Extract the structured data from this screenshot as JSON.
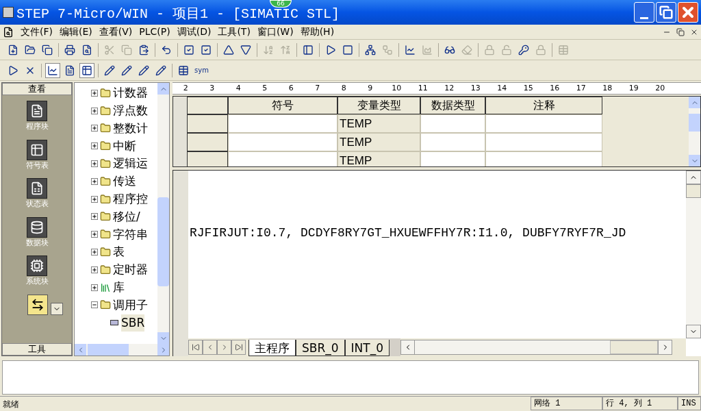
{
  "window": {
    "title": "STEP 7-Micro/WIN - 项目1 - [SIMATIC STL]",
    "badge": "66"
  },
  "menu": [
    "文件(F)",
    "编辑(E)",
    "查看(V)",
    "PLC(P)",
    "调试(D)",
    "工具(T)",
    "窗口(W)",
    "帮助(H)"
  ],
  "toolbar_1": [
    {
      "disabled": false
    },
    {
      "disabled": false
    },
    {
      "disabled": false
    },
    {
      "disabled": false
    },
    {
      "disabled": false
    },
    {
      "disabled": true
    },
    {
      "disabled": true
    },
    {
      "disabled": false
    },
    {
      "disabled": false
    },
    {
      "disabled": false
    },
    {
      "disabled": false
    },
    {
      "disabled": false
    },
    {
      "disabled": false
    },
    {
      "disabled": true
    },
    {
      "disabled": true
    },
    {
      "disabled": false
    },
    {
      "disabled": false
    },
    {
      "disabled": false
    },
    {
      "disabled": false
    },
    {
      "disabled": true
    },
    {
      "disabled": false
    },
    {
      "disabled": true
    },
    {
      "disabled": false
    },
    {
      "disabled": true
    },
    {
      "disabled": true
    },
    {
      "disabled": true
    },
    {
      "disabled": false
    },
    {
      "disabled": true
    },
    {
      "disabled": true
    }
  ],
  "toolbar_2": [
    {
      "pressed": false
    },
    {
      "pressed": false
    },
    {
      "pressed": true
    },
    {
      "pressed": false
    },
    {
      "pressed": true
    },
    {
      "pressed": false
    },
    {
      "pressed": false
    },
    {
      "pressed": false
    },
    {
      "pressed": false
    },
    {
      "pressed": false
    },
    {
      "pressed": false
    }
  ],
  "toolbar_2_label": "sym",
  "navigation_bar": {
    "header": "查看",
    "items": [
      {
        "label": "程序块"
      },
      {
        "label": "符号表"
      },
      {
        "label": "状态表"
      },
      {
        "label": "数据块"
      },
      {
        "label": "系统块"
      }
    ],
    "footer": "工具"
  },
  "tree": [
    {
      "label": "计数器",
      "expanded": false
    },
    {
      "label": "浮点数",
      "expanded": false
    },
    {
      "label": "整数计",
      "expanded": false
    },
    {
      "label": "中断",
      "expanded": false
    },
    {
      "label": "逻辑运",
      "expanded": false
    },
    {
      "label": "传送",
      "expanded": false
    },
    {
      "label": "程序控",
      "expanded": false
    },
    {
      "label": "移位/",
      "expanded": false
    },
    {
      "label": "字符串",
      "expanded": false
    },
    {
      "label": "表",
      "expanded": false
    },
    {
      "label": "定时器",
      "expanded": false
    },
    {
      "label": "库",
      "expanded": false
    },
    {
      "label": "调用子",
      "expanded": true,
      "children": [
        {
          "label": "SBR",
          "selected": true
        }
      ]
    }
  ],
  "ruler": [
    "2",
    "3",
    "4",
    "5",
    "6",
    "7",
    "8",
    "9",
    "10",
    "11",
    "12",
    "13",
    "14",
    "15",
    "16",
    "17",
    "18",
    "19",
    "20"
  ],
  "variable_table": {
    "columns": [
      "符号",
      "变量类型",
      "数据类型",
      "注释"
    ],
    "rows": [
      [
        "",
        "TEMP",
        "",
        ""
      ],
      [
        "",
        "TEMP",
        "",
        ""
      ],
      [
        "",
        "TEMP",
        "",
        ""
      ]
    ]
  },
  "editor": {
    "code_line": "RJFIRJUT:I0.7, DCDYF8RY7GT_HXUEWFFHY7R:I1.0, DUBFY7RYF7R_JD"
  },
  "sheet_tabs": [
    {
      "label": "主程序",
      "selected": true
    },
    {
      "label": "SBR_0",
      "selected": false
    },
    {
      "label": "INT_0",
      "selected": false
    }
  ],
  "status_bar": {
    "message": "就绪",
    "network": "网络 1",
    "position": "行 4, 列 1",
    "mode": "INS"
  }
}
